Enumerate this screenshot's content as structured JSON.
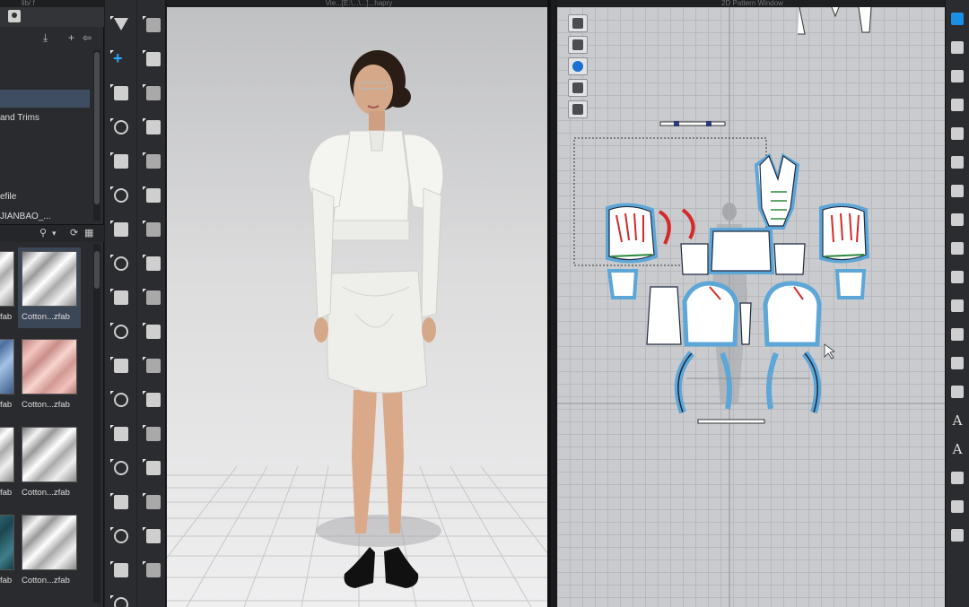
{
  "left_panel": {
    "top_label": "lib/ f",
    "tree_items": [
      {
        "label": "",
        "selected": false
      },
      {
        "label": "",
        "selected": false
      },
      {
        "label": "",
        "selected": true
      },
      {
        "label": "and Trims",
        "selected": false
      },
      {
        "label": "",
        "selected": false
      },
      {
        "label": "",
        "selected": false
      },
      {
        "label": "",
        "selected": false
      },
      {
        "label": "efile",
        "selected": false
      },
      {
        "label": "JIANBAO_...",
        "selected": false
      }
    ],
    "search_icons": [
      "search-icon",
      "chevron-down-icon",
      "refresh-icon",
      "grid-view-icon"
    ],
    "fabrics": [
      {
        "label": "fab",
        "swatch": "white",
        "col": 0,
        "row": 0,
        "selected": false
      },
      {
        "label": "Cotton...zfab",
        "swatch": "white",
        "col": 1,
        "row": 0,
        "selected": true
      },
      {
        "label": "fab",
        "swatch": "blue",
        "col": 0,
        "row": 1,
        "selected": false
      },
      {
        "label": "Cotton...zfab",
        "swatch": "pink",
        "col": 1,
        "row": 1,
        "selected": false
      },
      {
        "label": "fab",
        "swatch": "white",
        "col": 0,
        "row": 2,
        "selected": false
      },
      {
        "label": "Cotton...zfab",
        "swatch": "white",
        "col": 1,
        "row": 2,
        "selected": false
      },
      {
        "label": "fab",
        "swatch": "teal",
        "col": 0,
        "row": 3,
        "selected": false
      },
      {
        "label": "Cotton...zfab",
        "swatch": "white",
        "col": 1,
        "row": 3,
        "selected": false
      }
    ]
  },
  "viewport_3d": {
    "title": "Vie...[E:\\...\\...]...hapry"
  },
  "pattern_window": {
    "title": "2D Pattern Window",
    "tools": [
      "select-pattern-icon",
      "garment-icon",
      "info-icon",
      "sheet-icon",
      "lock-garment-icon"
    ]
  },
  "toolbar_3d_left": [
    "arrow-down-icon",
    "walk-avatar-icon",
    "transform-move-icon",
    "pin-icon",
    "select-icon",
    "move-icon",
    "tack-icon",
    "fold-icon",
    "garment-icon",
    "strengthen-icon",
    "edit-curve-icon",
    "measure-icon",
    "steam-icon",
    "seam-icon",
    "texture-icon",
    "pin-tool-icon",
    "rotate-icon",
    "button-icon",
    "fold-arrange-icon",
    "trim-icon",
    "sleeve-icon",
    "zip-icon",
    "skirt-icon",
    "shirt-icon",
    "avatar-icon",
    "mirror-icon",
    "cut-icon",
    "shade-icon",
    "pattern-link-icon",
    "transfer-icon",
    "needle-icon",
    "wrap-icon",
    "cross-arrows-icon",
    "puff-icon",
    "lock-icon"
  ],
  "toolbar_right": [
    "cursor-icon",
    "adjust-icon",
    "edit-point-icon",
    "polygon-icon",
    "rectangle-icon",
    "internal-polygon-icon",
    "ellipse-icon",
    "trace-icon",
    "seam-line-icon",
    "dart-icon",
    "split-icon",
    "segment-icon",
    "measure-line-icon",
    "ruler-icon",
    "text-A-icon",
    "text-serif-A-icon",
    "grid-lines-icon",
    "scale-icon",
    "avatar-figure-icon"
  ],
  "colors": {
    "accent_blue": "#1a8fe3",
    "plus_blue": "#29a8ff",
    "selection": "#3f4d62",
    "pattern_outline": "#5da6d8",
    "seam_red": "#d42a2a"
  }
}
